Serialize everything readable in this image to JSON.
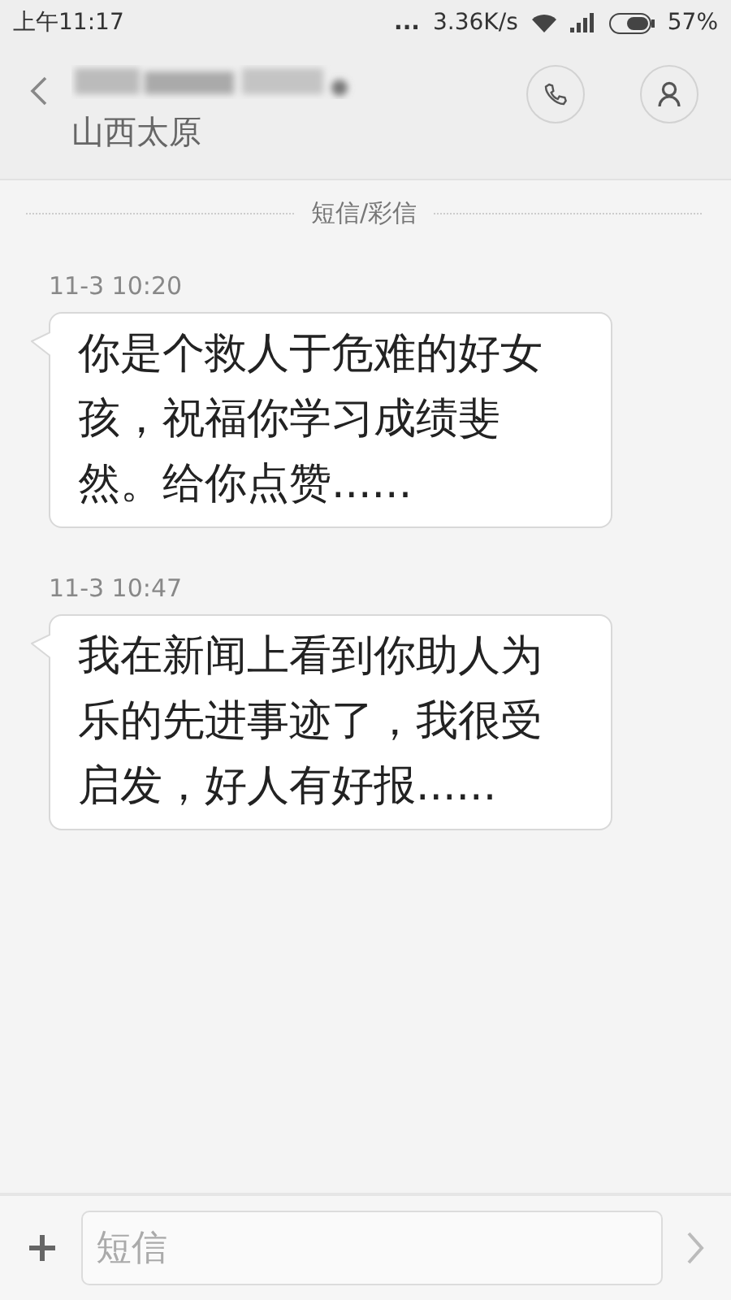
{
  "status_bar": {
    "time": "上午11:17",
    "dots": "...",
    "speed": "3.36K/s",
    "battery": "57%"
  },
  "header": {
    "subtitle": "山西太原"
  },
  "divider_label": "短信/彩信",
  "messages": [
    {
      "time": "11-3 10:20",
      "text": "你是个救人于危难的好女孩，祝福你学习成绩斐然。给你点赞......"
    },
    {
      "time": "11-3 10:47",
      "text": "我在新闻上看到你助人为乐的先进事迹了，我很受启发，好人有好报......"
    }
  ],
  "composer": {
    "placeholder": "短信"
  }
}
